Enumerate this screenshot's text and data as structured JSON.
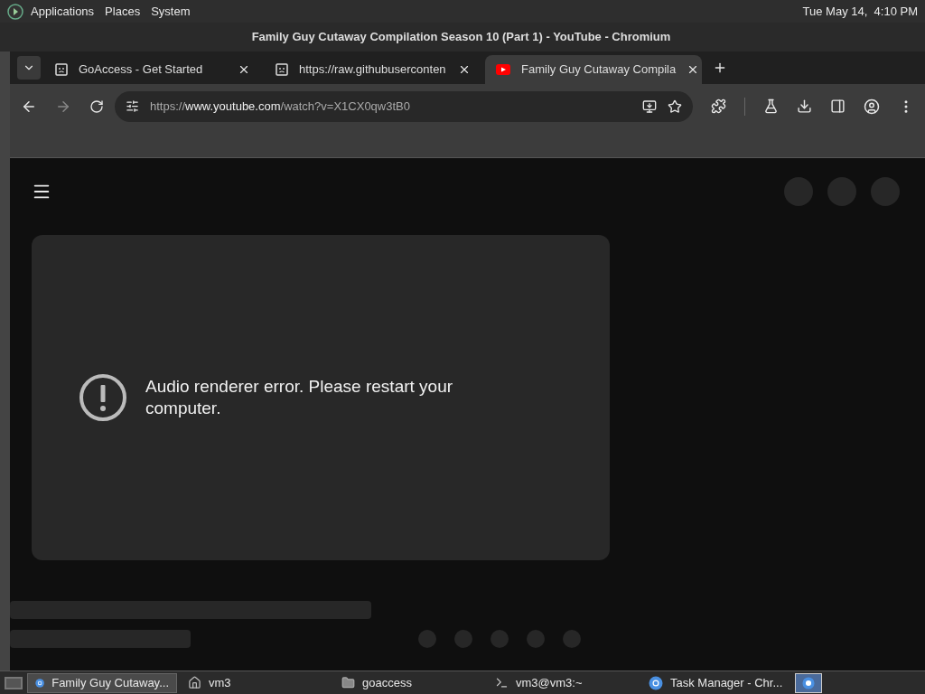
{
  "top_panel": {
    "menus": [
      "Applications",
      "Places",
      "System"
    ],
    "clock": "Tue May 14,  4:10 PM"
  },
  "window": {
    "title": "Family Guy Cutaway Compilation Season 10 (Part 1) - YouTube - Chromium"
  },
  "tabs": [
    {
      "title": "GoAccess - Get Started",
      "kind": "error",
      "selected": false
    },
    {
      "title": "https://raw.githubuserconten",
      "kind": "error",
      "selected": false
    },
    {
      "title": "Family Guy Cutaway Compila",
      "kind": "youtube",
      "selected": true
    }
  ],
  "address": {
    "scheme": "https://",
    "host": "www.youtube.com",
    "path": "/watch?v=X1CX0qw3tB0"
  },
  "player": {
    "message": "Audio renderer error. Please restart your computer."
  },
  "taskbar": [
    {
      "label": "Family Guy Cutaway...",
      "kind": "browser",
      "selected": true
    },
    {
      "label": "vm3",
      "kind": "home",
      "selected": false
    },
    {
      "label": "goaccess",
      "kind": "folder",
      "selected": false
    },
    {
      "label": "vm3@vm3:~",
      "kind": "terminal",
      "selected": false
    },
    {
      "label": "Task Manager - Chr...",
      "kind": "browser",
      "selected": false
    }
  ]
}
